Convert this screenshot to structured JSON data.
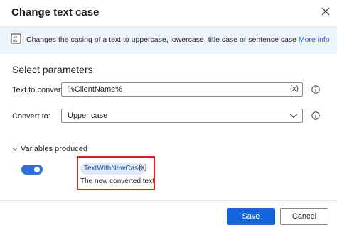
{
  "dialog": {
    "title": "Change text case"
  },
  "info": {
    "text": "Changes the casing of a text to uppercase, lowercase, title case or sentence case",
    "link": "More info"
  },
  "section": {
    "title": "Select parameters"
  },
  "fields": {
    "text_to_convert": {
      "label": "Text to convert:",
      "value": "%ClientName%",
      "var_button": "{x}"
    },
    "convert_to": {
      "label": "Convert to:",
      "value": "Upper case"
    }
  },
  "variables": {
    "header": "Variables produced",
    "enabled": true,
    "name": "TextWithNewCase",
    "var_button": "{x}",
    "description": "The new converted text"
  },
  "buttons": {
    "save": "Save",
    "cancel": "Cancel"
  },
  "colors": {
    "primary": "#1464dc",
    "highlight_box": "#e21a1a",
    "info_bg": "#eef4fb",
    "link": "#2563c9"
  }
}
